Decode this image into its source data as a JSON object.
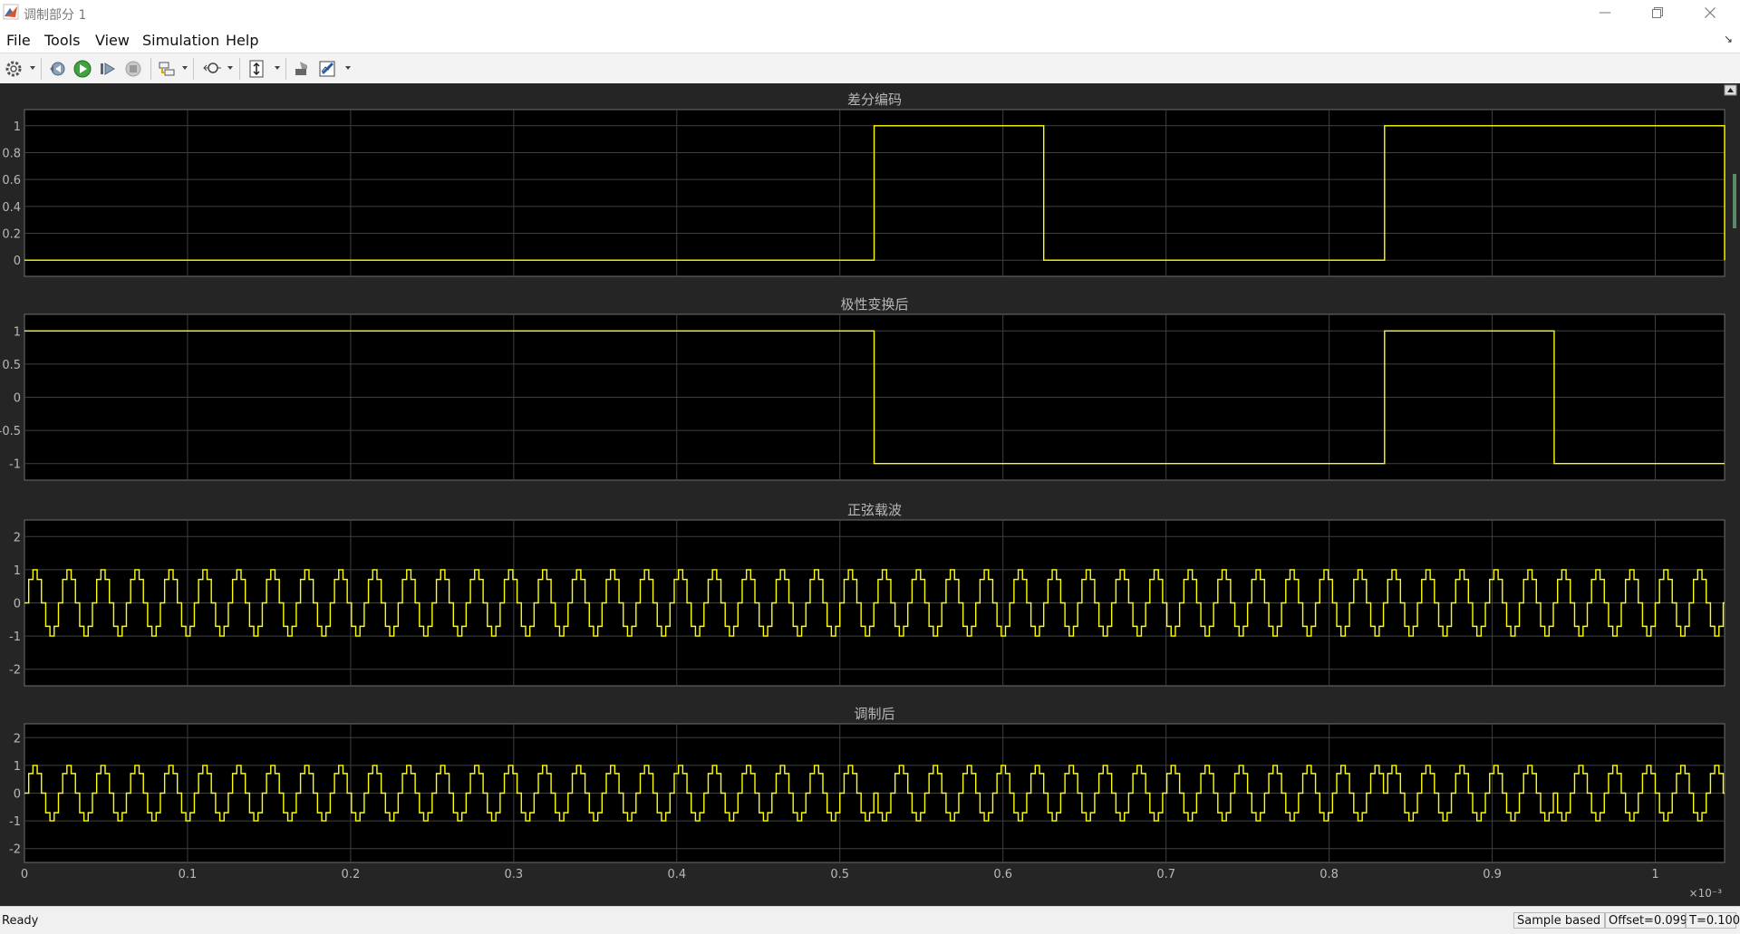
{
  "window": {
    "title": "调制部分 1",
    "icon": "matlab-icon"
  },
  "menu": [
    "File",
    "Tools",
    "View",
    "Simulation",
    "Help"
  ],
  "toolbar": {
    "icons": [
      "settings-icon",
      "step-back-icon",
      "run-icon",
      "step-forward-icon",
      "stop-icon",
      "highlight-icon",
      "zoom-icon",
      "scale-axes-icon",
      "style-icon",
      "measurements-icon"
    ]
  },
  "colors": {
    "background": "#252525",
    "plot": "#000000",
    "signal": "#ffff00",
    "grid": "#404040",
    "text": "#b8b8b8"
  },
  "status": {
    "ready": "Ready",
    "mode": "Sample based",
    "offset": "Offset=0.099",
    "time": "T=0.100"
  },
  "chart_data": [
    {
      "type": "line",
      "title": "差分编码",
      "x_ticks": [
        0,
        0.1,
        0.2,
        0.3,
        0.4,
        0.5,
        0.6,
        0.7,
        0.8,
        0.9,
        1
      ],
      "x_multiplier": "×10⁻³",
      "xlim": [
        0,
        1.0425
      ],
      "ylim": [
        -0.12,
        1.12
      ],
      "y_ticks": [
        "0",
        "0.2",
        "0.4",
        "0.6",
        "0.8",
        "1"
      ],
      "y_tick_values": [
        0,
        0.2,
        0.4,
        0.6,
        0.8,
        1
      ],
      "series": [
        {
          "step": [
            [
              0,
              0
            ],
            [
              0.521,
              1
            ],
            [
              0.625,
              0
            ],
            [
              0.834,
              1
            ],
            [
              1.0425,
              0
            ]
          ]
        }
      ],
      "grid": true
    },
    {
      "type": "line",
      "title": "极性变换后",
      "xlim": [
        0,
        1.0425
      ],
      "ylim": [
        -1.25,
        1.25
      ],
      "y_ticks": [
        "-1",
        "-0.5",
        "0",
        "0.5",
        "1"
      ],
      "y_tick_values": [
        -1,
        -0.5,
        0,
        0.5,
        1
      ],
      "series": [
        {
          "step": [
            [
              0,
              1
            ],
            [
              0.521,
              -1
            ],
            [
              0.834,
              1
            ],
            [
              0.938,
              -1
            ]
          ]
        }
      ],
      "grid": true
    },
    {
      "type": "line",
      "title": "正弦载波",
      "xlim": [
        0,
        1.0425
      ],
      "ylim": [
        -2.5,
        2.5
      ],
      "y_ticks": [
        "-2",
        "-1",
        "0",
        "1",
        "2"
      ],
      "y_tick_values": [
        -2,
        -1,
        0,
        1,
        2
      ],
      "carrier": {
        "period": 0.020833,
        "amplitude": 1,
        "samples_per_period": 8
      },
      "grid": true
    },
    {
      "type": "line",
      "title": "调制后",
      "xlim": [
        0,
        1.0425
      ],
      "ylim": [
        -2.5,
        2.5
      ],
      "y_ticks": [
        "-2",
        "-1",
        "0",
        "1",
        "2"
      ],
      "y_tick_values": [
        -2,
        -1,
        0,
        1,
        2
      ],
      "carrier": {
        "period": 0.020833,
        "amplitude": 1,
        "samples_per_period": 8
      },
      "modulated_by": 1,
      "grid": true
    }
  ]
}
